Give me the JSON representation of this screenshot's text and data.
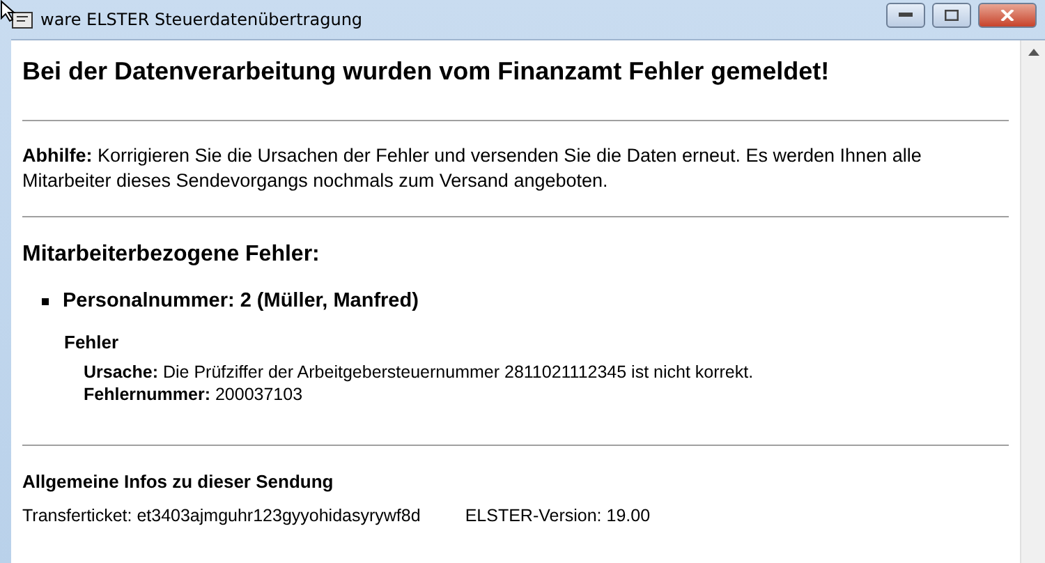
{
  "window": {
    "title": "ware ELSTER Steuerdatenübertragung",
    "buttons": [
      {
        "kind": "minimize"
      },
      {
        "kind": "maximize"
      },
      {
        "kind": "close"
      }
    ]
  },
  "heading": "Bei der Datenverarbeitung wurden vom Finanzamt Fehler gemeldet!",
  "remedy": "**Abhilfe:** Korrigieren Sie die Ursachen der Fehler und versenden Sie die Daten erneut. Es werden Ihnen alle Mitarbeiter dieses Sendevorgangs nochmals zum Versand angeboten.",
  "employee_errors": {
    "title": "Mitarbeiterbezogene Fehler:",
    "items": [
      {
        "title": "Personalnummer: 2 (Müller, Manfred)",
        "errors_title": "Fehler",
        "lines": [
          "**Ursache:** Die Prüfziffer der Arbeitgebersteuernummer 2811021112345 ist nicht korrekt.",
          "**Fehlernummer:** 200037103"
        ]
      }
    ]
  },
  "general": {
    "title": "Allgemeine Infos zu dieser Sendung",
    "transfer_ticket": "Transferticket: et3403ajmguhr123gyyohidasyrywf8d",
    "version": "ELSTER-Version: 19.00"
  }
}
